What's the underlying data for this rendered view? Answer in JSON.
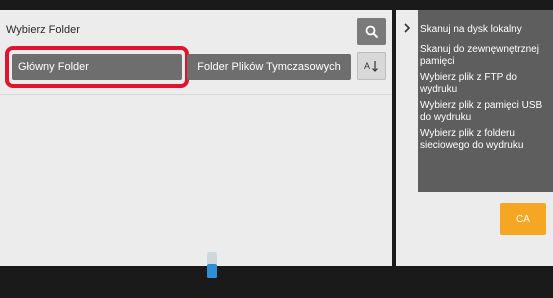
{
  "header": {
    "title": "Wybierz Folder"
  },
  "folders": {
    "main": "Główny Folder",
    "temp": "Folder Plików Tymczasowych"
  },
  "side_menu": {
    "items": [
      "Skanuj na dysk lokalny",
      "Skanuj do zewnęwnętrznej pamięci",
      "Wybierz plik z FTP do wydruku",
      "Wybierz plik z pamięci USB do wydruku",
      "Wybierz plik z folderu sieciowego do wydruku"
    ],
    "ca_label": "CA"
  },
  "icons": {
    "search": "search-icon",
    "sort": "sort-icon",
    "expand": "chevron-right-icon",
    "toner": "toner-icon"
  },
  "colors": {
    "highlight": "#e0142e",
    "accent": "#f5a623"
  }
}
